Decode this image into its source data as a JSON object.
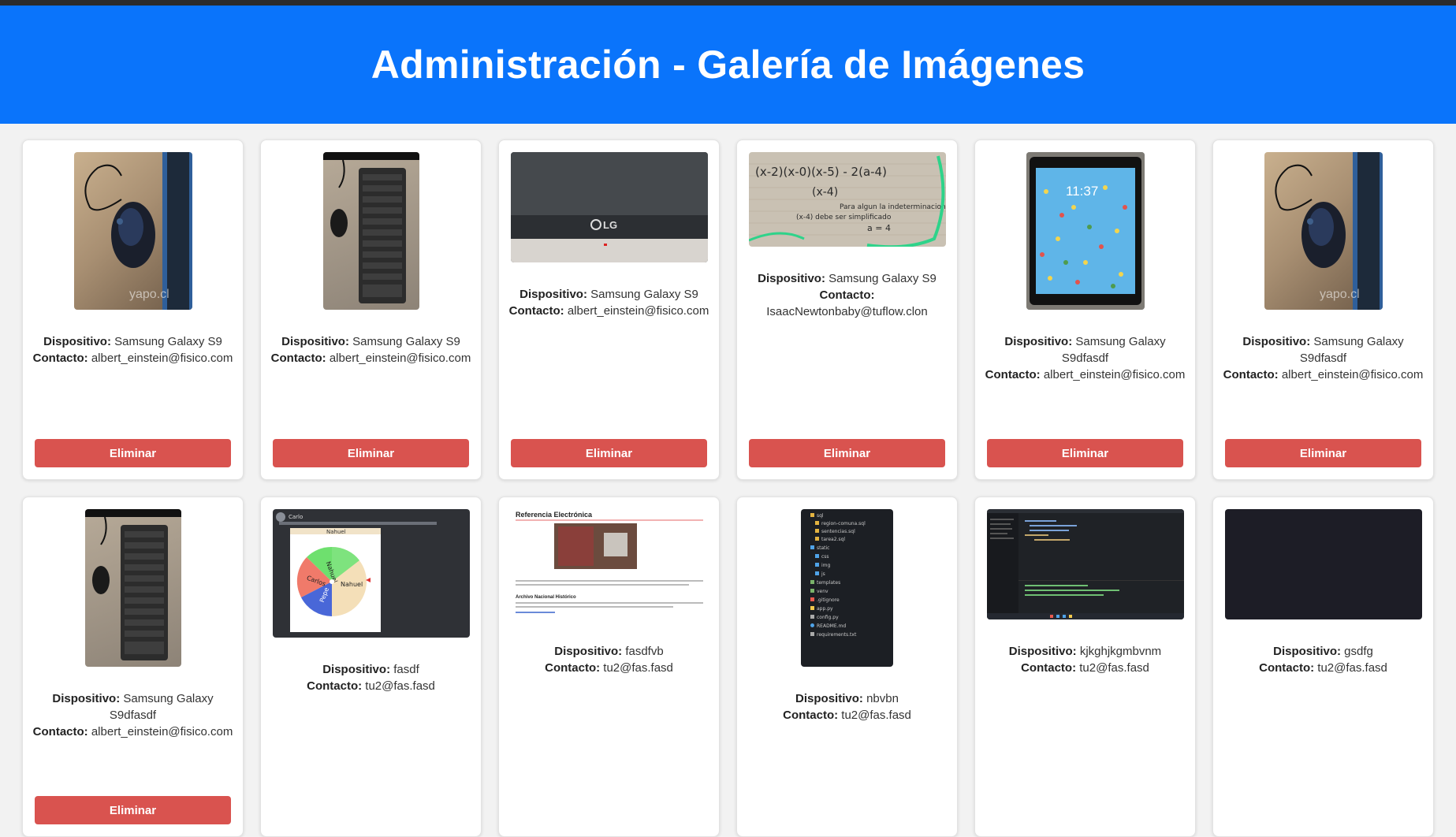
{
  "page": {
    "title": "Administración - Galería de Imágenes"
  },
  "labels": {
    "device": "Dispositivo:",
    "contact": "Contacto:",
    "delete": "Eliminar"
  },
  "cards": [
    {
      "image": "mouse-photo",
      "device": "Samsung Galaxy S9",
      "contact": "albert_einstein@fisico.com",
      "watermark": "yapo.cl"
    },
    {
      "image": "keyboard-photo",
      "device": "Samsung Galaxy S9",
      "contact": "albert_einstein@fisico.com"
    },
    {
      "image": "tv-photo",
      "device": "Samsung Galaxy S9",
      "contact": "albert_einstein@fisico.com",
      "brand": "LG"
    },
    {
      "image": "math-notes-photo",
      "device": "Samsung Galaxy S9",
      "contact": "IsaacNewtonbaby@tuflow.clon",
      "notes": [
        "(x-2)(x-0)(x-5) - 2(a-4)",
        "(x-4)",
        "Para algun la indeterminacion",
        "(x-4) debe ser simplificado",
        "a = 4"
      ]
    },
    {
      "image": "tablet-photo",
      "device": "Samsung Galaxy S9dfasdf",
      "contact": "albert_einstein@fisico.com",
      "clock": "11:37"
    },
    {
      "image": "mouse-photo",
      "device": "Samsung Galaxy S9dfasdf",
      "contact": "albert_einstein@fisico.com",
      "watermark": "yapo.cl"
    },
    {
      "image": "keyboard-photo",
      "device": "Samsung Galaxy S9dfasdf",
      "contact": "albert_einstein@fisico.com"
    },
    {
      "image": "wheel-screenshot",
      "device": "fasdf",
      "contact": "tu2@fas.fasd",
      "chat_user": "Carlo",
      "wheel_names": [
        "Nahuel",
        "Nahuel",
        "Carlos",
        "Pepe"
      ]
    },
    {
      "image": "document-screenshot",
      "device": "fasdfvb",
      "contact": "tu2@fas.fasd",
      "doc_title": "Referencia Electrónica",
      "doc_section": "Archivo Nacional Histórico"
    },
    {
      "image": "file-tree-screenshot",
      "device": "nbvbn",
      "contact": "tu2@fas.fasd",
      "files": [
        "sql",
        "region-comuna.sql",
        "sentencias.sql",
        "tarea2.sql",
        "static",
        "css",
        "img",
        "js",
        "templates",
        "venv",
        ".gitignore",
        "app.py",
        "config.py",
        "README.md",
        "requirements.txt"
      ]
    },
    {
      "image": "code-editor-screenshot",
      "device": "kjkghjkgmbvnm",
      "contact": "tu2@fas.fasd"
    },
    {
      "image": "dark-screenshot",
      "device": "gsdfg",
      "contact": "tu2@fas.fasd"
    }
  ],
  "colors": {
    "header": "#0a74fb",
    "delete_button": "#d9534f",
    "background": "#f2f2f2"
  }
}
